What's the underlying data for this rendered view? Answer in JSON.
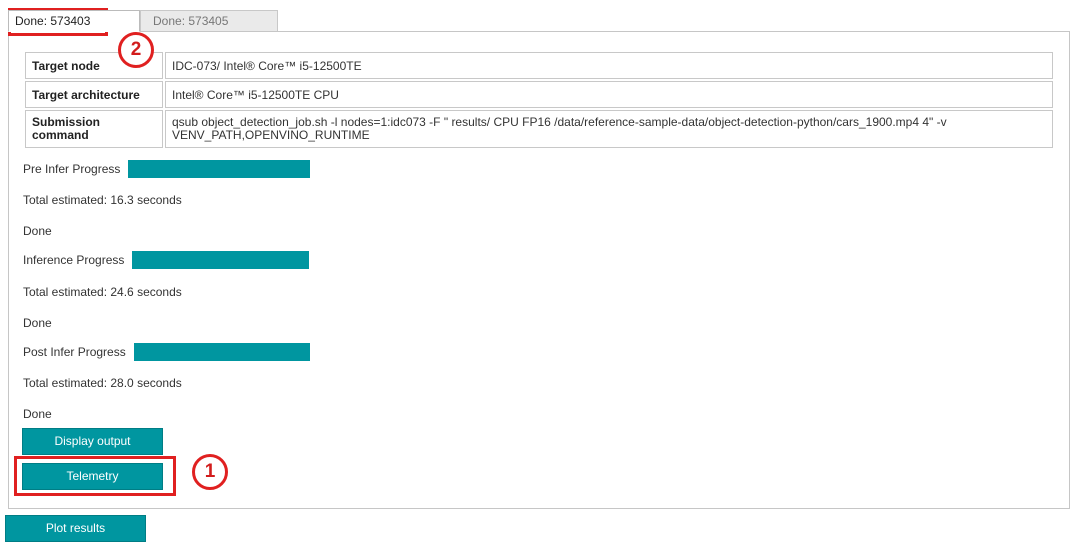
{
  "tabs": [
    {
      "label": "Done: 573403",
      "active": true
    },
    {
      "label": "Done: 573405",
      "active": false
    }
  ],
  "info_table": [
    {
      "key": "Target node",
      "value": "IDC-073/ Intel® Core™ i5-12500TE"
    },
    {
      "key": "Target architecture",
      "value": "Intel® Core™ i5-12500TE CPU"
    },
    {
      "key": "Submission command",
      "value": "qsub object_detection_job.sh -l nodes=1:idc073 -F \" results/ CPU FP16 /data/reference-sample-data/object-detection-python/cars_1900.mp4 4\" -v VENV_PATH,OPENVINO_RUNTIME"
    }
  ],
  "progress": [
    {
      "label": "Pre Infer Progress",
      "value": 100,
      "estimate": "Total estimated: 16.3 seconds",
      "status": "Done"
    },
    {
      "label": "Inference Progress",
      "value": 100,
      "estimate": "Total estimated: 24.6 seconds",
      "status": "Done"
    },
    {
      "label": "Post Infer Progress",
      "value": 100,
      "estimate": "Total estimated: 28.0 seconds",
      "status": "Done"
    }
  ],
  "buttons": {
    "display_output": "Display output",
    "telemetry": "Telemetry",
    "plot_results": "Plot results"
  },
  "annotations": {
    "badge_1": "1",
    "badge_2": "2",
    "color": "#e02020"
  },
  "colors": {
    "accent": "#0096a0"
  }
}
